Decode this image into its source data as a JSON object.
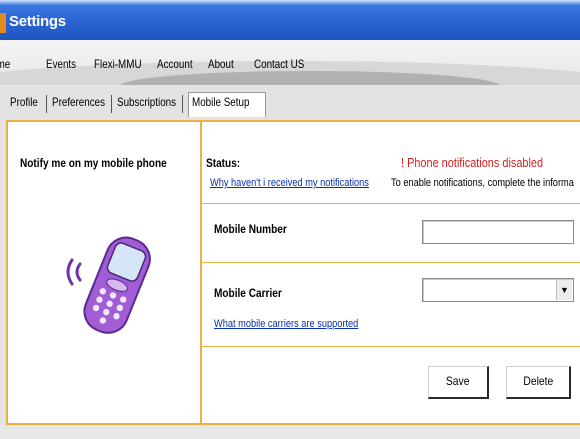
{
  "window": {
    "title": "Settings"
  },
  "menu": [
    "Home",
    "Events",
    "Flexi-MMU",
    "Account",
    "About",
    "Contact US"
  ],
  "tabs": [
    {
      "label": "Profile",
      "active": false
    },
    {
      "label": "Preferences",
      "active": false
    },
    {
      "label": "Subscriptions",
      "active": false
    },
    {
      "label": "Mobile Setup",
      "active": true
    }
  ],
  "left_panel": {
    "heading": "Notify me on my mobile phone",
    "phone_icon": "mobile-phone-ringing-icon"
  },
  "status": {
    "label": "Status:",
    "help_link": "Why haven't i received my notifications",
    "alert": "! Phone notifications disabled",
    "message": "To enable notifications, complete the informa"
  },
  "mobile_number": {
    "label": "Mobile Number",
    "value": ""
  },
  "mobile_carrier": {
    "label": "Mobile Carrier",
    "selected": "",
    "help_link": "What mobile carriers are supported"
  },
  "buttons": {
    "save": "Save",
    "delete": "Delete"
  },
  "colors": {
    "title_bar": "#2a64d2",
    "panel_border": "#ecb046",
    "alert_red": "#d42020",
    "link_blue": "#0a2fb2"
  }
}
